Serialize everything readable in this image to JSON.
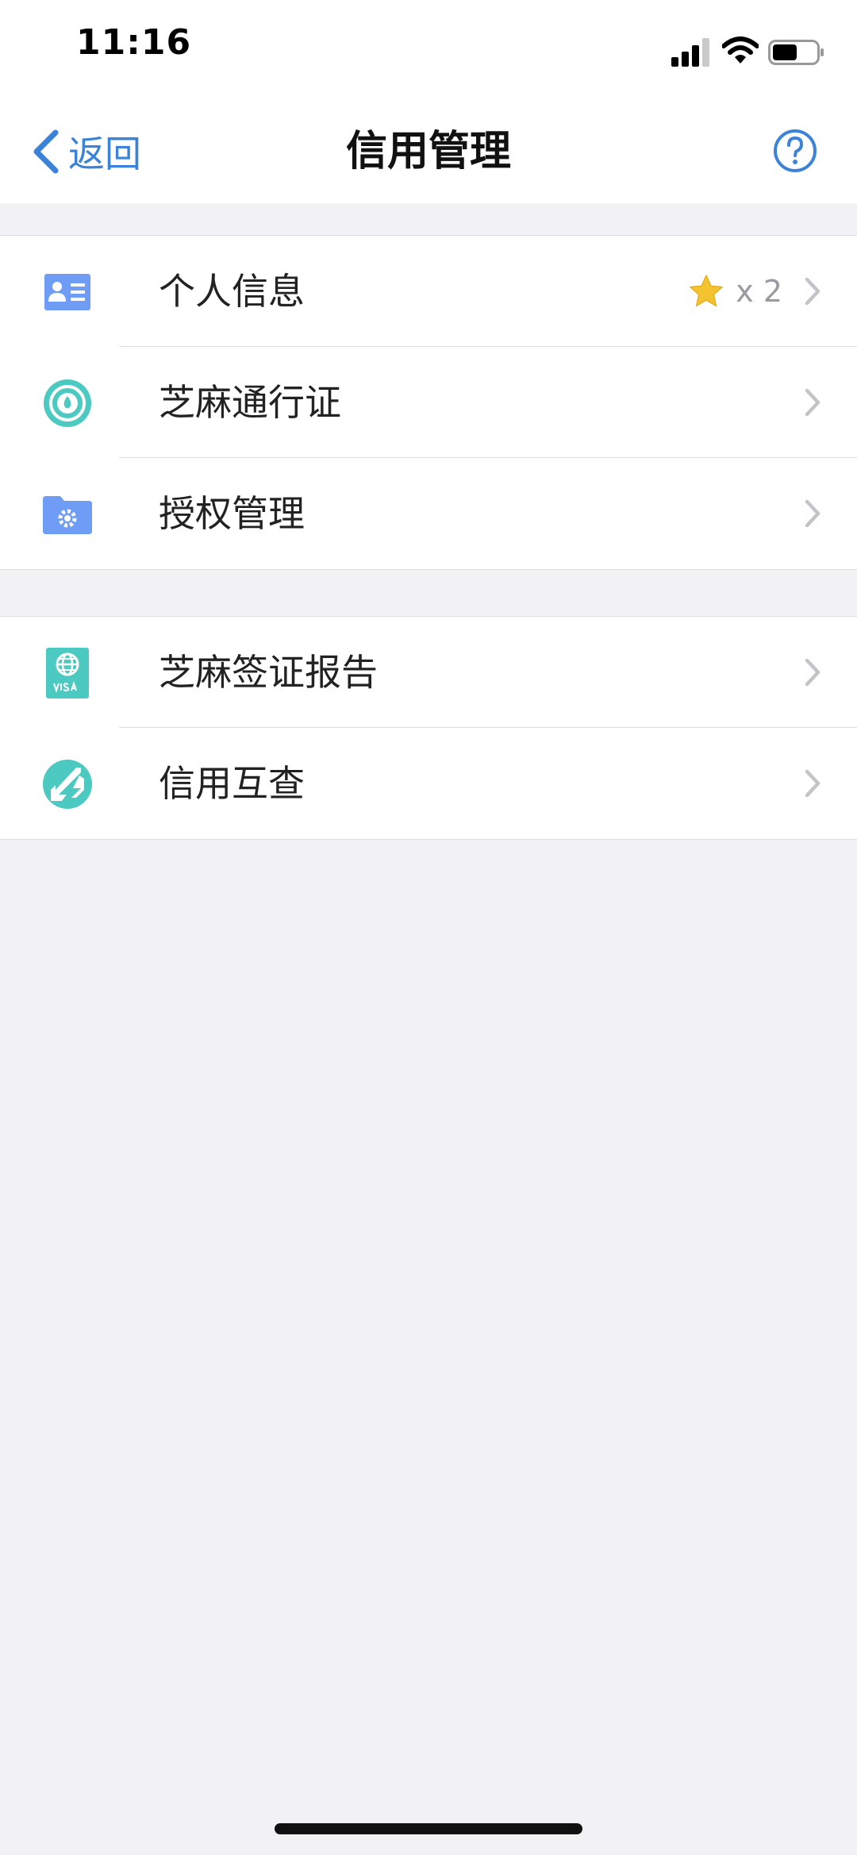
{
  "status_bar": {
    "time": "11:16",
    "signal_icon": "cellular-signal-icon",
    "wifi_icon": "wifi-icon",
    "battery_icon": "battery-icon"
  },
  "nav": {
    "back_label": "返回",
    "title": "信用管理",
    "help_icon": "question-circle-icon"
  },
  "groups": [
    {
      "items": [
        {
          "label": "个人信息",
          "icon": "id-card-icon",
          "badge": {
            "icon": "star-icon",
            "count": "x 2"
          }
        },
        {
          "label": "芝麻通行证",
          "icon": "sesame-passport-icon"
        },
        {
          "label": "授权管理",
          "icon": "folder-gear-icon"
        }
      ]
    },
    {
      "items": [
        {
          "label": "芝麻签证报告",
          "icon": "visa-passport-icon"
        },
        {
          "label": "信用互查",
          "icon": "mutual-check-icon"
        }
      ]
    }
  ],
  "colors": {
    "accent": "#3b82d9",
    "background": "#f2f2f5",
    "id_icon": "#6f9cf4",
    "teal_icon": "#4cc9c0",
    "star": "#f4c430",
    "chevron": "#c4c4c8"
  }
}
